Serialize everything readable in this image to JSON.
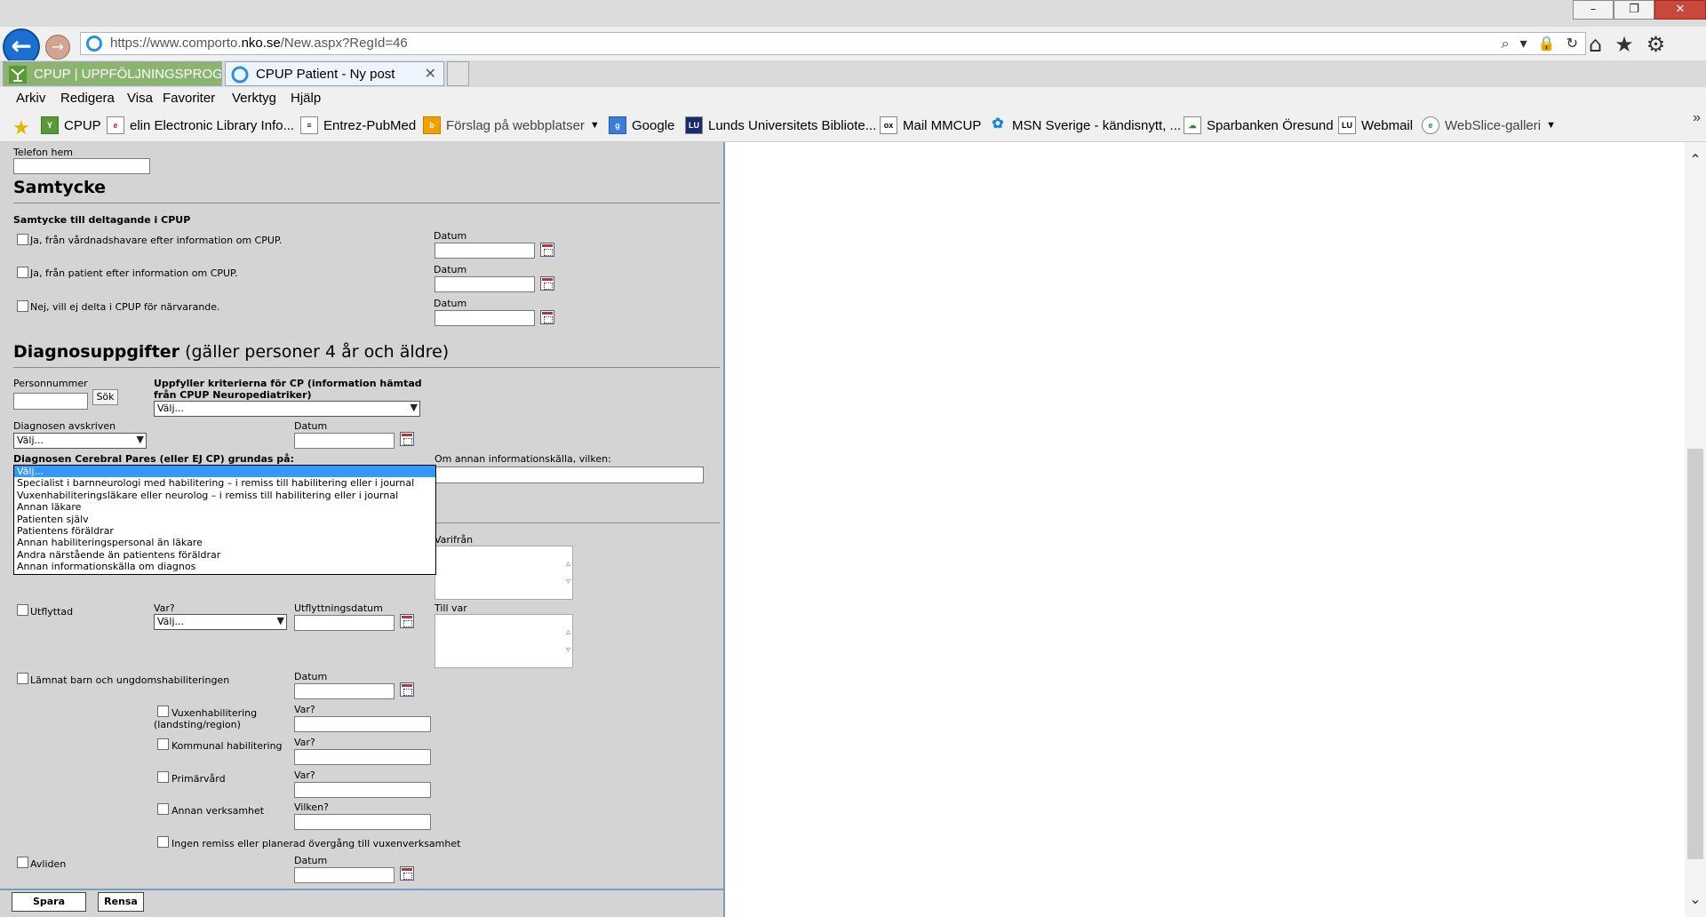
{
  "browser": {
    "url_prefix": "https://www.comporto.",
    "url_domain": "nko.se",
    "url_path": "/New.aspx?RegId=46",
    "back_label": "←",
    "forward_label": "→",
    "tabs": [
      {
        "label": "CPUP | UPPFÖLJNINGSPROGRA..."
      },
      {
        "label": "CPUP Patient - Ny post",
        "close": "✕"
      }
    ],
    "menu": [
      "Arkiv",
      "Redigera",
      "Visa",
      "Favoriter",
      "Verktyg",
      "Hjälp"
    ],
    "favorites": [
      {
        "label": "CPUP",
        "icon": "cpup-icon"
      },
      {
        "label": "elin Electronic Library Info...",
        "icon": "elin-icon"
      },
      {
        "label": "Entrez-PubMed",
        "icon": "pubmed-icon"
      },
      {
        "label": "Förslag på webbplatser",
        "icon": "bing-icon"
      },
      {
        "label": "Google",
        "icon": "google-icon"
      },
      {
        "label": "Lunds Universitets Bibliote...",
        "icon": "lu-icon"
      },
      {
        "label": "Mail MMCUP",
        "icon": "mail-icon"
      },
      {
        "label": "MSN Sverige - kändisnytt, ...",
        "icon": "msn-icon"
      },
      {
        "label": "Sparbanken Öresund",
        "icon": "sparbanken-icon"
      },
      {
        "label": "Webmail",
        "icon": "webmail-icon"
      },
      {
        "label": "WebSlice-galleri",
        "icon": "webslice-icon"
      }
    ],
    "colors": {
      "accent": "#1b6fd1",
      "tab_active": "#8bb46f",
      "panel": "#d4d4d4",
      "close": "#c9483c"
    }
  },
  "form": {
    "telefon_hem_label": "Telefon hem",
    "samtycke": {
      "heading": "Samtycke",
      "subheading": "Samtycke till deltagande i CPUP",
      "options": [
        {
          "label": "Ja, från vårdnadshavare efter information om CPUP.",
          "date_label": "Datum"
        },
        {
          "label": "Ja, från patient efter information om CPUP.",
          "date_label": "Datum"
        },
        {
          "label": "Nej, vill ej delta i CPUP för närvarande.",
          "date_label": "Datum"
        }
      ]
    },
    "diagnos": {
      "heading_bold": "Diagnosuppgifter",
      "heading_light": " (gäller personer 4 år och äldre)",
      "personnummer_label": "Personnummer",
      "sok_label": "Sök",
      "kriterier_label_1": "Uppfyller kriterierna för CP (information hämtad",
      "kriterier_label_2": "från CPUP Neuropediatriker)",
      "kriterier_value": "Välj...",
      "avskriven_label": "Diagnosen avskriven",
      "avskriven_value": "Välj...",
      "datum_label": "Datum",
      "grundas_label": "Diagnosen Cerebral Pares (eller EJ CP) grundas på:",
      "annan_kalla_label": "Om annan informationskälla, vilken:",
      "grundas_options": [
        "Välj...",
        "Specialist i barnneurologi med habilitering – i remiss till habilitering eller i journal",
        "Vuxenhabiliteringsläkare eller neurolog – i remiss till habilitering eller i journal",
        "Annan läkare",
        "Patienten själv",
        "Patientens föräldrar",
        "Annan habiliteringspersonal än läkare",
        "Andra närstående än patientens föräldrar",
        "Annan informationskälla om diagnos"
      ]
    },
    "varifran_label": "Varifrån",
    "utflyttad": {
      "label": "Utflyttad",
      "var_label": "Var?",
      "var_value": "Välj...",
      "datum_label": "Utflyttningsdatum",
      "till_var_label": "Till var"
    },
    "lamnat": {
      "label": "Lämnat barn och ungdomshabiliteringen",
      "datum_label": "Datum",
      "items": [
        {
          "label_1": "Vuxenhabilitering",
          "label_2": "(landsting/region)",
          "field_label": "Var?"
        },
        {
          "label_1": "Kommunal habilitering",
          "field_label": "Var?"
        },
        {
          "label_1": "Primärvård",
          "field_label": "Var?"
        },
        {
          "label_1": "Annan verksamhet",
          "field_label": "Vilken?"
        }
      ],
      "ingen_label": "Ingen remiss eller planerad övergång till vuxenverksamhet"
    },
    "avliden": {
      "label": "Avliden",
      "datum_label": "Datum"
    },
    "buttons": {
      "spara": "Spara",
      "rensa": "Rensa"
    }
  }
}
